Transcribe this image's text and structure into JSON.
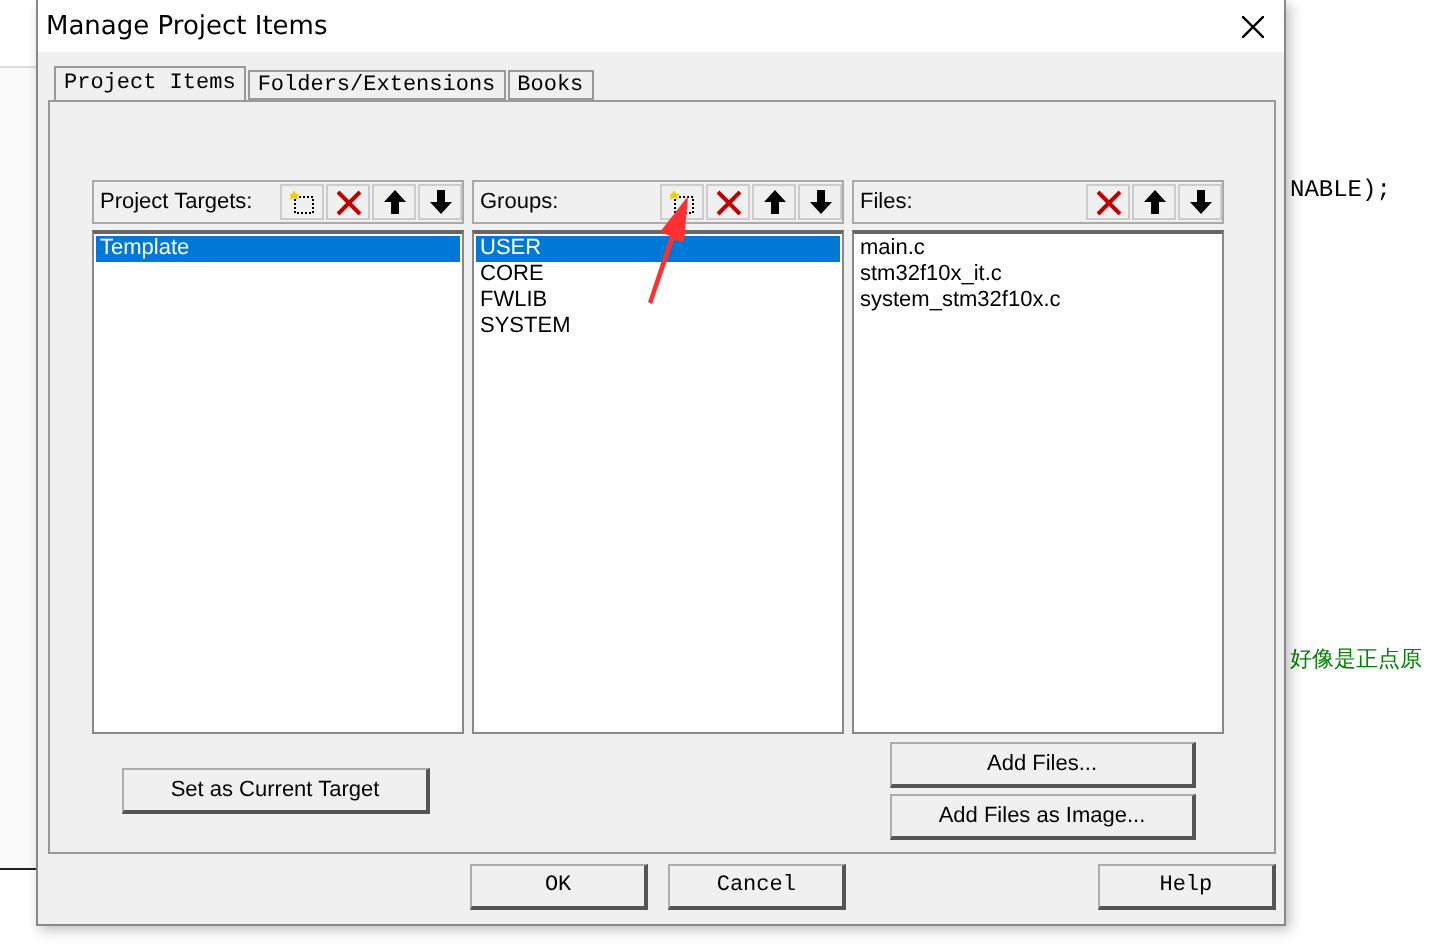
{
  "window": {
    "title": "Manage Project Items"
  },
  "tabs": [
    {
      "label": "Project Items",
      "selected": true
    },
    {
      "label": "Folders/Extensions",
      "selected": false
    },
    {
      "label": "Books",
      "selected": false
    }
  ],
  "panels": [
    {
      "label": "Project Targets:",
      "tools": [
        {
          "kind": "new"
        },
        {
          "kind": "delete"
        },
        {
          "kind": "up"
        },
        {
          "kind": "down"
        }
      ],
      "items": [
        {
          "text": "Template",
          "selected": true
        }
      ]
    },
    {
      "label": "Groups:",
      "tools": [
        {
          "kind": "new"
        },
        {
          "kind": "delete"
        },
        {
          "kind": "up"
        },
        {
          "kind": "down"
        }
      ],
      "items": [
        {
          "text": "USER",
          "selected": true
        },
        {
          "text": "CORE",
          "selected": false
        },
        {
          "text": "FWLIB",
          "selected": false
        },
        {
          "text": "SYSTEM",
          "selected": false
        }
      ]
    },
    {
      "label": "Files:",
      "tools": [
        {
          "kind": "delete"
        },
        {
          "kind": "up"
        },
        {
          "kind": "down"
        }
      ],
      "items": [
        {
          "text": "main.c",
          "selected": false
        },
        {
          "text": "stm32f10x_it.c",
          "selected": false
        },
        {
          "text": "system_stm32f10x.c",
          "selected": false
        }
      ]
    }
  ],
  "target_button": "Set as Current Target",
  "file_buttons": [
    "Add Files...",
    "Add Files as Image..."
  ],
  "footer_buttons": [
    "OK",
    "Cancel",
    "Help"
  ],
  "editor": {
    "code_line": "NABLE);",
    "comment_line": "好像是正点原"
  }
}
